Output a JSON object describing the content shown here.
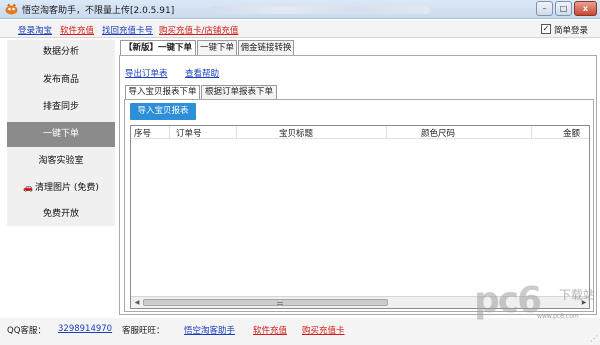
{
  "window": {
    "title": "悟空淘客助手，不限量上传[2.0.5.91]",
    "buttons": {
      "minimize": "–",
      "maximize": "□",
      "close": "x"
    }
  },
  "toplinks": [
    {
      "label": "登录淘宝",
      "color": "#1b3fbb"
    },
    {
      "label": "软件充值",
      "color": "#d0201a"
    },
    {
      "label": "找回充值卡号",
      "color": "#1b3fbb"
    },
    {
      "label": "购买充值卡/店铺充值",
      "color": "#d0201a"
    }
  ],
  "simple_login": {
    "label": "简单登录",
    "checked": true,
    "mark": "✓"
  },
  "sidebar": {
    "items": [
      {
        "label": "数据分析"
      },
      {
        "label": "发布商品"
      },
      {
        "label": "排查同步"
      },
      {
        "label": "一键下单",
        "active": true
      },
      {
        "label": "淘客实验室"
      },
      {
        "label": "清理图片 (免费)",
        "icon": "car-icon",
        "icon_char": "🚗"
      },
      {
        "label": "免费开放"
      }
    ]
  },
  "main_tabs": [
    {
      "label": "【新版】一键下单",
      "active": true
    },
    {
      "label": "一键下单"
    },
    {
      "label": "佣金链接转换"
    }
  ],
  "panel_links": {
    "export_orders": "导出订单表",
    "view_help": "查看帮助"
  },
  "sub_tabs": [
    {
      "label": "导入宝贝报表下单",
      "active": true
    },
    {
      "label": "根据订单报表下单"
    }
  ],
  "import_button": "导入宝贝报表",
  "grid": {
    "columns": [
      "序号",
      "订单号",
      "宝贝标题",
      "颜色尺码",
      "金额"
    ],
    "rows": []
  },
  "scrollbar": {
    "left_arrow": "◀",
    "right_arrow": "▶"
  },
  "footer": {
    "qq_label": "QQ客服：",
    "qq_number": "3298914970",
    "wangwang_label": "客服旺旺：",
    "wangwang_name": "悟空淘客助手",
    "recharge": "软件充值",
    "buy_card": "购买充值卡"
  },
  "watermark": {
    "brand": "pc6",
    "site": "www.pc6.com",
    "logo": "下载站"
  }
}
